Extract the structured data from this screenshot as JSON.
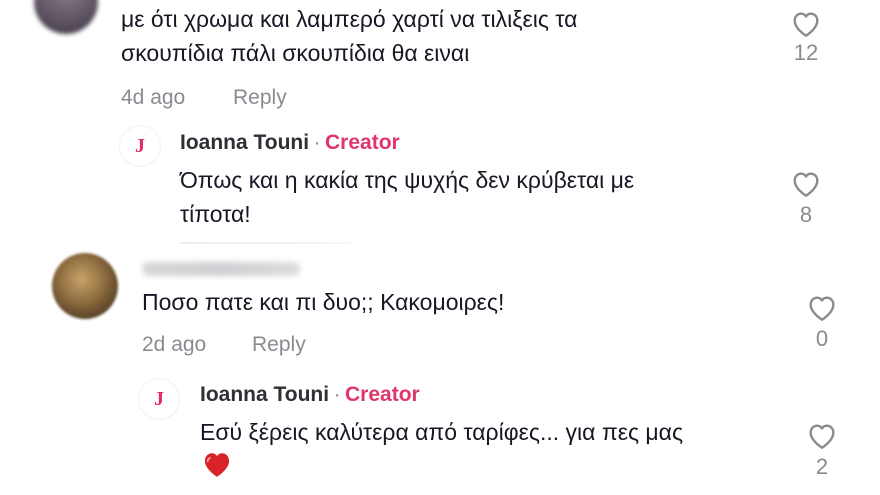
{
  "comments": [
    {
      "text_line1": "με ότι χρωμα και λαμπερό χαρτί να τιλιξεις τα",
      "text_line2": "σκουπίδια πάλι σκουπίδια θα ειναι",
      "time": "4d ago",
      "reply": "Reply",
      "likes": "12",
      "reply_item": {
        "author": "Ioanna Touni",
        "separator": "·",
        "badge": "Creator",
        "avatar_letter": "J",
        "text_line1": "Όπως και η κακία της ψυχής δεν κρύβεται με",
        "text_line2": "τίποτα!",
        "likes": "8"
      }
    },
    {
      "text": "Ποσο πατε και πι δυο;; Κακομοιρες!",
      "time": "2d ago",
      "reply": "Reply",
      "likes": "0",
      "reply_item": {
        "author": "Ioanna Touni",
        "separator": "·",
        "badge": "Creator",
        "avatar_letter": "J",
        "text": "Εσύ ξέρεις καλύτερα από ταρίφες... για πες μας",
        "emoji": "❤️",
        "likes": "2"
      }
    }
  ],
  "colors": {
    "creator": "#e0366b",
    "meta": "#8a8b91",
    "text": "#161823"
  }
}
